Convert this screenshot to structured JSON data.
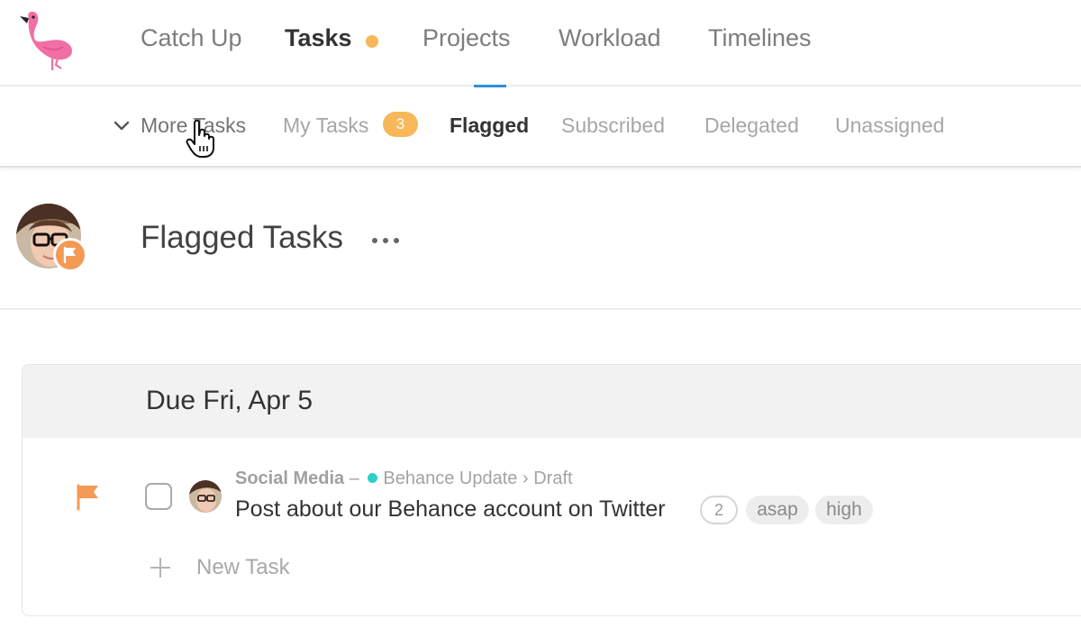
{
  "colors": {
    "accent_orange": "#f6b859",
    "flag_orange": "#f39a55",
    "active_tab_underline": "#2f8fd6",
    "project_dot": "#2ed0c6"
  },
  "logo": {
    "icon": "flamingo-logo"
  },
  "top_nav": {
    "items": [
      {
        "label": "Catch Up",
        "active": false
      },
      {
        "label": "Tasks",
        "active": true,
        "indicator": "orange-dot"
      },
      {
        "label": "Projects",
        "active": false
      },
      {
        "label": "Workload",
        "active": false
      },
      {
        "label": "Timelines",
        "active": false
      }
    ]
  },
  "sub_nav": {
    "more_label": "More Tasks",
    "more_icon": "chevron-down-icon",
    "items": [
      {
        "label": "My Tasks",
        "badge": "3",
        "active": false
      },
      {
        "label": "Flagged",
        "active": true
      },
      {
        "label": "Subscribed",
        "active": false
      },
      {
        "label": "Delegated",
        "active": false
      },
      {
        "label": "Unassigned",
        "active": false
      }
    ]
  },
  "page": {
    "title": "Flagged Tasks",
    "menu_icon": "more-horizontal-icon",
    "avatar_badge_icon": "flag-icon"
  },
  "groups": [
    {
      "title": "Due Fri, Apr 5",
      "tasks": [
        {
          "flagged": true,
          "checked": false,
          "project": "Social Media",
          "separator": "–",
          "list": "Behance Update",
          "crumb_arrow": "›",
          "section": "Draft",
          "title": "Post about our Behance account on Twitter",
          "comment_count": "2",
          "tags": [
            "asap",
            "high"
          ]
        }
      ],
      "new_task_label": "New Task"
    }
  ]
}
